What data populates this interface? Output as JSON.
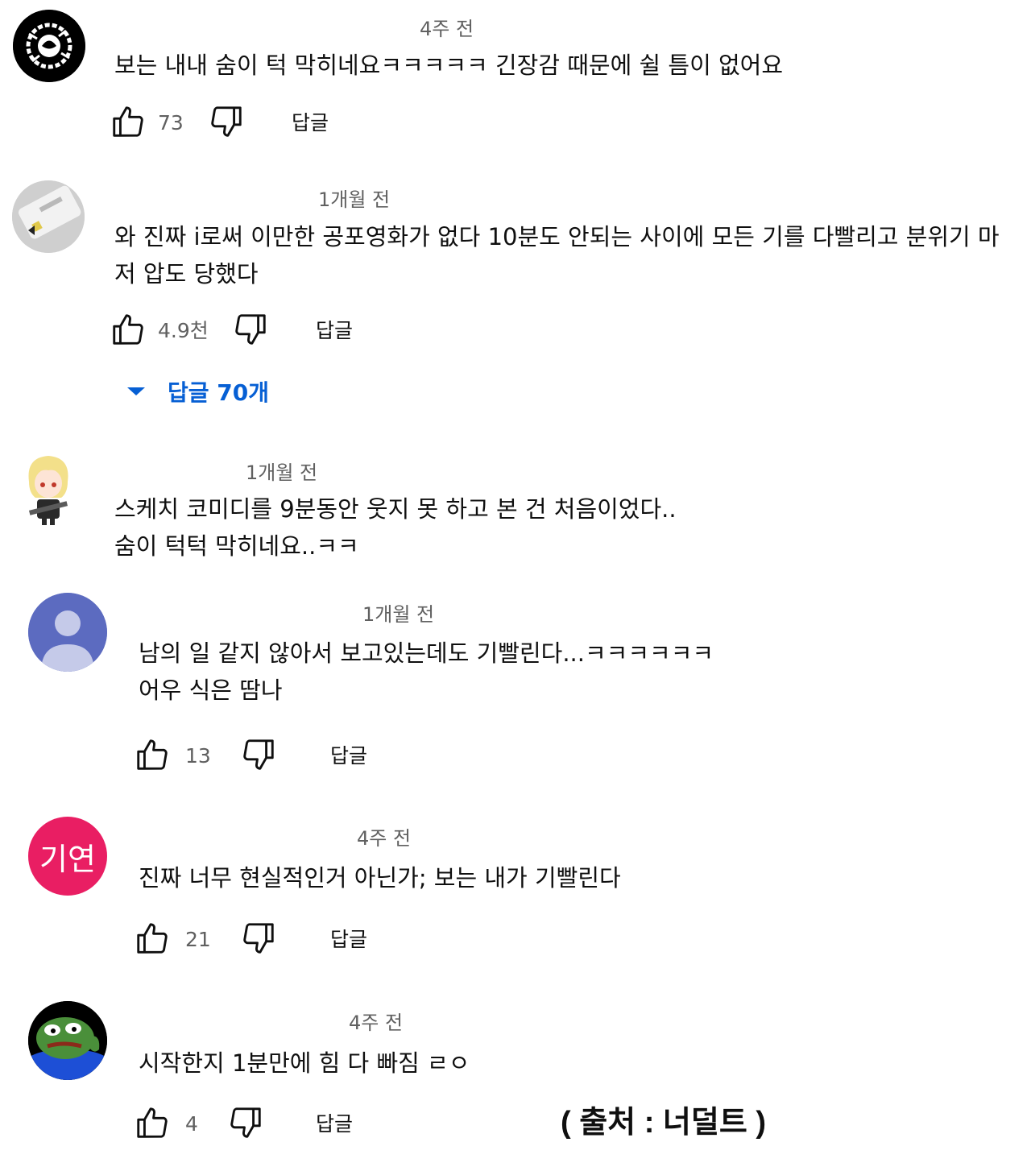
{
  "comments": [
    {
      "time": "4주 전",
      "text": "보는 내내 숨이 턱 막히네요ㅋㅋㅋㅋㅋ 긴장감 때문에 쉴 틈이 없어요",
      "likes": "73",
      "reply_label": "답글"
    },
    {
      "time": "1개월 전",
      "text": "와 진짜 i로써 이만한 공포영화가 없다 10분도 안되는 사이에 모든 기를 다빨리고 분위기 마\n저 압도 당했다",
      "likes": "4.9천",
      "reply_label": "답글",
      "replies_toggle": "답글 70개"
    },
    {
      "time": "1개월 전",
      "text": "스케치 코미디를 9분동안 웃지 못 하고 본 건 처음이었다..\n숨이 턱턱 막히네요..ㅋㅋ"
    },
    {
      "time": "1개월 전",
      "text": "남의 일 같지 않아서 보고있는데도 기빨린다...ㅋㅋㅋㅋㅋㅋ\n어우 식은 땀나",
      "likes": "13",
      "reply_label": "답글"
    },
    {
      "time": "4주 전",
      "avatar_text": "기연",
      "text": "진짜 너무 현실적인거 아닌가; 보는 내가 기빨린다",
      "likes": "21",
      "reply_label": "답글"
    },
    {
      "time": "4주 전",
      "text": "시작한지 1분만에 힘 다 빠짐 ㄹㅇ",
      "likes": "4",
      "reply_label": "답글"
    }
  ],
  "source_caption": "( 출처 : 너덜트 )",
  "colors": {
    "link_blue": "#065fd4",
    "meta_gray": "#606060",
    "default_avatar": "#5c6bc0",
    "giyeon_avatar": "#e91e63"
  },
  "icons": [
    "like-icon",
    "dislike-icon",
    "expand-arrow-icon",
    "default-user-icon"
  ]
}
